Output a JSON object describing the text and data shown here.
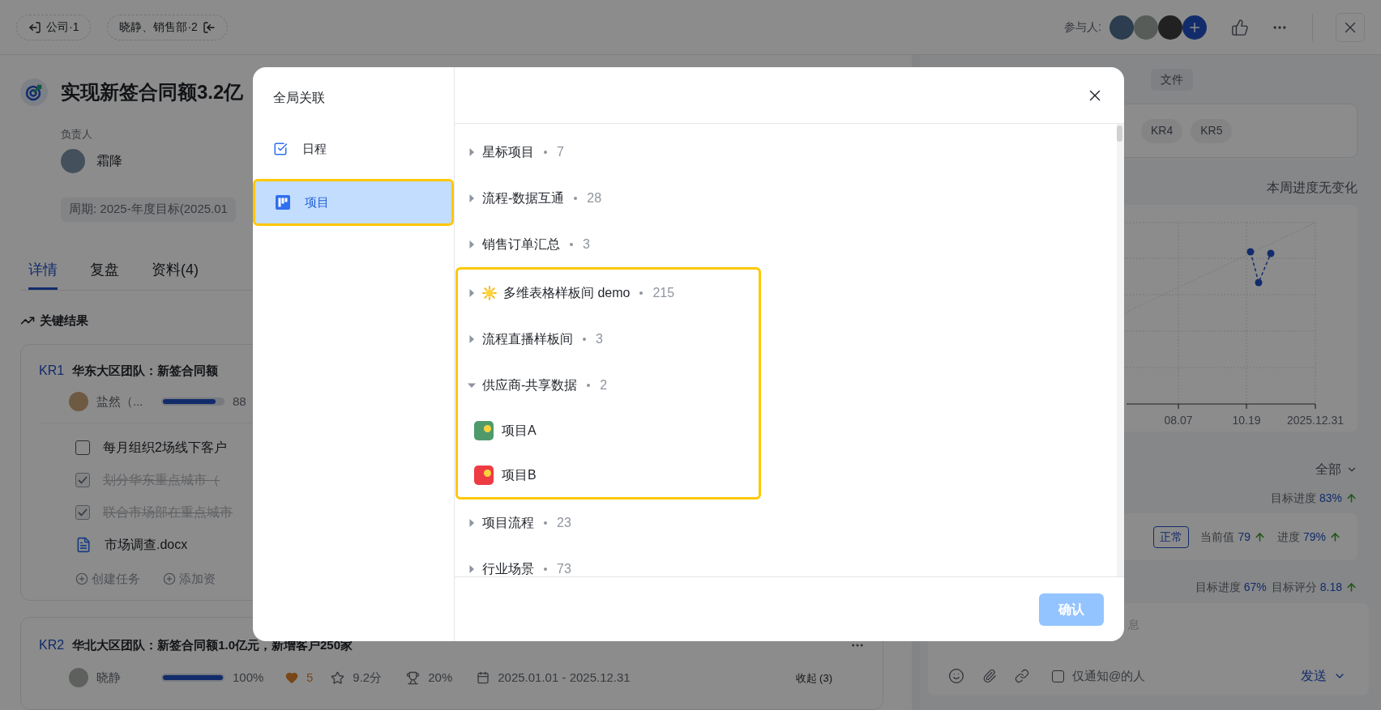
{
  "top_bar": {
    "scope_chips": [
      {
        "label": "公司·1"
      },
      {
        "label": "晓静、销售部·2"
      }
    ],
    "participants_label": "参与人:"
  },
  "objective": {
    "title": "实现新签合同额3.2亿",
    "owner_label": "负责人",
    "owner": "霜降",
    "period": "周期: 2025-年度目标(2025.01"
  },
  "detail_tabs": [
    {
      "label": "详情",
      "selected": true
    },
    {
      "label": "复盘",
      "selected": false
    },
    {
      "label": "资料(4)",
      "selected": false
    }
  ],
  "key_results": {
    "heading": "关键结果",
    "items": [
      {
        "code": "KR1",
        "title": "华东大区团队：新签合同额",
        "owner": "盐然（...",
        "level": 0.88,
        "percent": "88",
        "tasks": [
          {
            "text": "每月组织2场线下客户",
            "checked": false
          },
          {
            "text": "划分华东重点城市（",
            "checked": true
          },
          {
            "text": "联合市场部在重点城市",
            "checked": true
          }
        ],
        "files": [
          "市场调查.docx"
        ],
        "actions": [
          "创建任务",
          "添加资"
        ]
      },
      {
        "code": "KR2",
        "title": "华北大区团队：新签合同额1.0亿元，新增客户250家",
        "owner": "晓静",
        "level": 1,
        "percent": "100%",
        "likes": "5",
        "score": "9.2分",
        "weight": "20%",
        "dates": "2025.01.01 - 2025.12.31",
        "collapse": "收起 (3)"
      }
    ]
  },
  "side_panel": {
    "tabs": [
      {
        "label": "文件",
        "selected": false
      }
    ],
    "kr_chips": [
      "KR4",
      "KR5"
    ],
    "trend_note": "本周进度无变化",
    "chart": {
      "x_labels": [
        "08.07",
        "10.19",
        "2025.12.31"
      ]
    },
    "filter": "全部",
    "goal_progress": {
      "label": "目标进度",
      "value": "83%",
      "rising": true
    },
    "kr_status": {
      "status": "正常",
      "metrics": [
        {
          "label": "当前值",
          "value": "79",
          "rising": true
        },
        {
          "label": "进度",
          "value": "79%",
          "rising": true
        }
      ]
    },
    "goal_summary": [
      {
        "label": "目标进度",
        "value": "67%",
        "rising": false
      },
      {
        "label": "目标评分",
        "value": "8.18",
        "rising": true
      }
    ],
    "comment": {
      "placeholder": "息",
      "notify_label": "仅通知@的人",
      "notify_checked": false,
      "send": "发送"
    }
  },
  "dialog": {
    "title": "全局关联",
    "nav": [
      {
        "label": "日程",
        "selected": false,
        "highlighted": false
      },
      {
        "label": "项目",
        "selected": true,
        "highlighted": true
      }
    ],
    "groups": [
      {
        "name": "星标项目",
        "kind": "plain",
        "count": "7",
        "expanded": false,
        "highlighted": false
      },
      {
        "name": "流程-数据互通",
        "kind": "plain",
        "count": "28",
        "expanded": false,
        "highlighted": false
      },
      {
        "name": "销售订单汇总",
        "kind": "plain",
        "count": "3",
        "expanded": false,
        "highlighted": false
      },
      {
        "name": "多维表格样板间 demo",
        "kind": "decorated",
        "count": "215",
        "expanded": false,
        "highlighted": true
      },
      {
        "name": "流程直播样板间",
        "kind": "plain",
        "count": "3",
        "expanded": false,
        "highlighted": true
      },
      {
        "name": "供应商-共享数据",
        "kind": "plain",
        "count": "2",
        "expanded": true,
        "highlighted": true,
        "children": [
          {
            "name": "项目A",
            "color": "#4f9a6b"
          },
          {
            "name": "项目B",
            "color": "#ee3b44"
          }
        ]
      },
      {
        "name": "项目流程",
        "kind": "plain",
        "count": "23",
        "expanded": false,
        "highlighted": false
      },
      {
        "name": "行业场景",
        "kind": "plain",
        "count": "73",
        "expanded": false,
        "highlighted": false
      }
    ],
    "confirm": {
      "label": "确认",
      "disabled": true
    }
  }
}
